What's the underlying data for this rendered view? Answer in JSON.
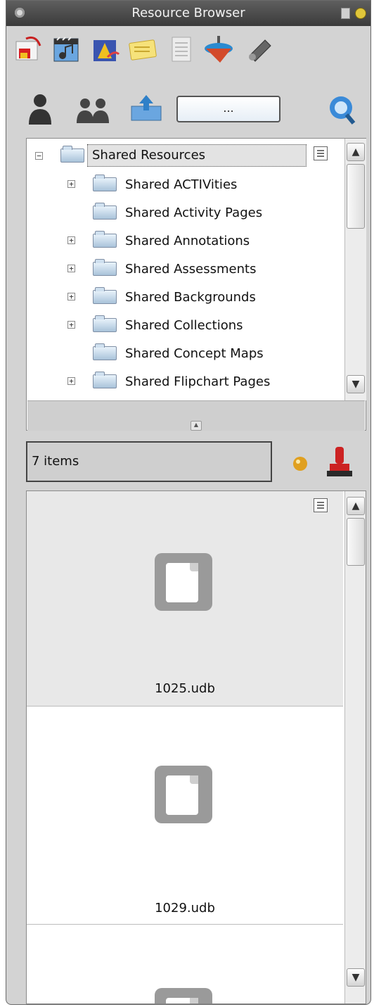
{
  "window": {
    "title": "Resource Browser"
  },
  "toolbar": {
    "icons": [
      "flipchart-icon",
      "media-icon",
      "animation-icon",
      "notes-icon",
      "pages-icon",
      "spinning-top-icon",
      "tools-icon"
    ]
  },
  "user_toolbar": {
    "path_button_label": "..."
  },
  "tree": {
    "root_label": "Shared Resources",
    "items": [
      {
        "label": "Shared ACTIVities",
        "expandable": true
      },
      {
        "label": "Shared Activity Pages",
        "expandable": false
      },
      {
        "label": "Shared Annotations",
        "expandable": true
      },
      {
        "label": "Shared Assessments",
        "expandable": true
      },
      {
        "label": "Shared Backgrounds",
        "expandable": true
      },
      {
        "label": "Shared Collections",
        "expandable": true
      },
      {
        "label": "Shared Concept Maps",
        "expandable": false
      },
      {
        "label": "Shared Flipchart Pages",
        "expandable": true
      }
    ]
  },
  "results": {
    "count_label": "7 items"
  },
  "files": [
    {
      "name": "1025.udb"
    },
    {
      "name": "1029.udb"
    }
  ],
  "colors": {
    "titlebar": "#3a3a3a",
    "panel": "#d3d3d3",
    "folder": "#a9c3da"
  }
}
